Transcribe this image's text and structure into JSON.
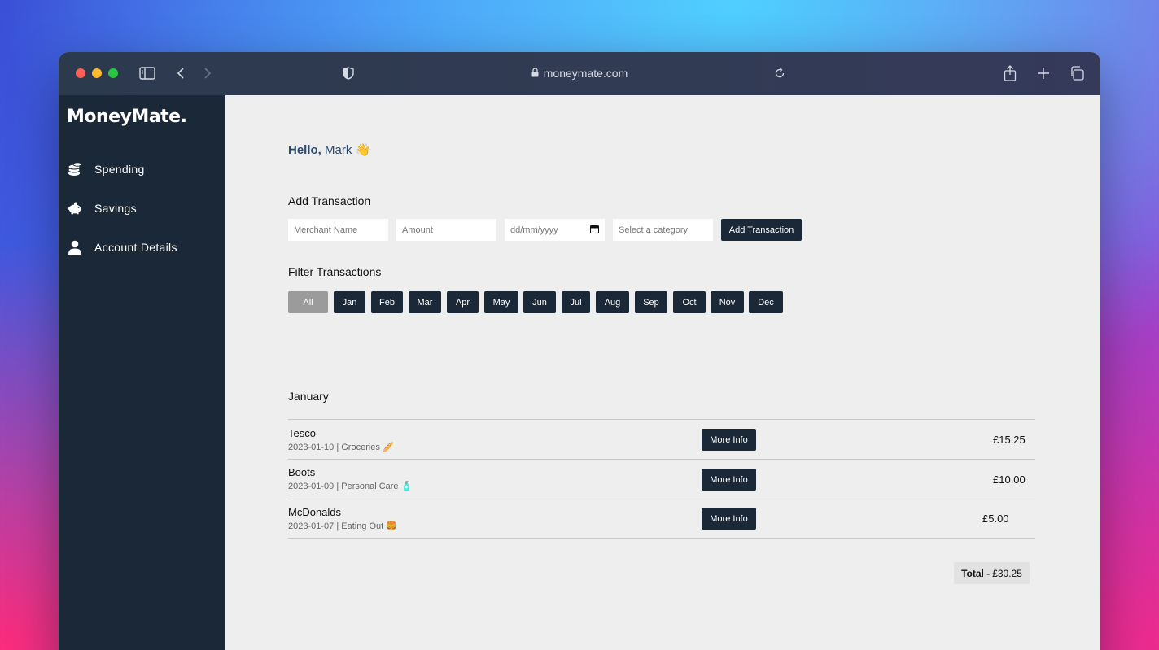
{
  "browser": {
    "url": "moneymate.com"
  },
  "sidebar": {
    "logo": "MoneyMate.",
    "items": [
      {
        "label": "Spending",
        "icon": "coins-icon"
      },
      {
        "label": "Savings",
        "icon": "piggy-bank-icon"
      },
      {
        "label": "Account Details",
        "icon": "user-icon"
      }
    ]
  },
  "greeting": {
    "hello": "Hello,",
    "name": "Mark",
    "emoji": "👋"
  },
  "add_transaction": {
    "title": "Add Transaction",
    "merchant_placeholder": "Merchant Name",
    "amount_placeholder": "Amount",
    "date_placeholder": "dd/mm/yyyy",
    "category_placeholder": "Select a category",
    "submit_label": "Add Transaction"
  },
  "filter": {
    "title": "Filter Transactions",
    "months": [
      "All",
      "Jan",
      "Feb",
      "Mar",
      "Apr",
      "May",
      "Jun",
      "Jul",
      "Aug",
      "Sep",
      "Oct",
      "Nov",
      "Dec"
    ],
    "selected": "All"
  },
  "transactions": {
    "month_title": "January",
    "more_info_label": "More Info",
    "rows": [
      {
        "merchant": "Tesco",
        "meta": "2023-01-10 | Groceries 🥖",
        "amount": "£15.25"
      },
      {
        "merchant": "Boots",
        "meta": "2023-01-09 | Personal Care 🧴",
        "amount": "£10.00"
      },
      {
        "merchant": "McDonalds",
        "meta": "2023-01-07 | Eating Out 🍔",
        "amount": "£5.00"
      }
    ],
    "total_label": "Total -",
    "total_value": "£30.25"
  },
  "colors": {
    "sidebar_bg": "#1b2838",
    "button_dark": "#1b2838",
    "button_selected": "#9b9b9b",
    "page_bg": "#eeeeee"
  }
}
